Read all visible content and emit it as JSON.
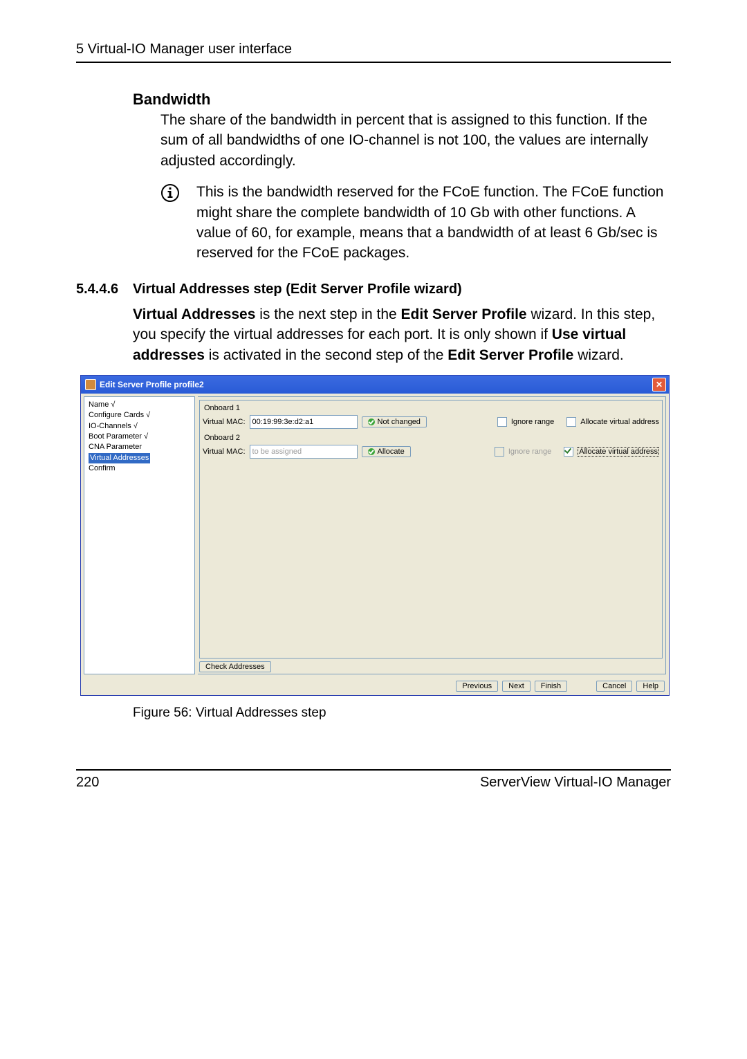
{
  "header": {
    "chapter": "5 Virtual-IO Manager user interface"
  },
  "bandwidth": {
    "title": "Bandwidth",
    "body": "The share of the bandwidth in percent that is assigned to this function. If the sum of all bandwidths of one IO-channel is not 100, the values are internally adjusted accordingly.",
    "note": "This is the bandwidth reserved for the FCoE function. The FCoE function might share the complete bandwidth of 10 Gb with other functions. A value of 60, for example, means that a bandwidth of at least 6 Gb/sec is reserved for the FCoE packages."
  },
  "subheading": {
    "num": "5.4.4.6",
    "text": "Virtual Addresses step (Edit Server Profile wizard)"
  },
  "para_parts": {
    "p1a": "Virtual Addresses",
    "p1b": " is the next step in the ",
    "p1c": "Edit Server Profile",
    "p1d": " wizard. In this step, you specify the virtual addresses for each port. It is only shown if ",
    "p1e": "Use virtual addresses",
    "p1f": " is activated in the second step of the ",
    "p1g": "Edit Server Profile",
    "p1h": " wizard."
  },
  "dialog": {
    "title": "Edit Server Profile profile2",
    "tree": {
      "items": [
        {
          "label": "Name",
          "checked": true,
          "selected": false
        },
        {
          "label": "Configure Cards",
          "checked": true,
          "selected": false
        },
        {
          "label": "IO-Channels",
          "checked": true,
          "selected": false
        },
        {
          "label": "Boot Parameter",
          "checked": true,
          "selected": false
        },
        {
          "label": "CNA Parameter",
          "checked": false,
          "selected": false
        },
        {
          "label": "Virtual Addresses",
          "checked": false,
          "selected": true
        },
        {
          "label": "Confirm",
          "checked": false,
          "selected": false
        }
      ]
    },
    "onboard1": {
      "group": "Onboard 1",
      "mac_label": "Virtual MAC:",
      "mac_value": "00:19:99:3e:d2:a1",
      "action_label": "Not changed",
      "ignore_label": "Ignore range",
      "ignore_checked": false,
      "allocate_label": "Allocate virtual address",
      "allocate_checked": false
    },
    "onboard2": {
      "group": "Onboard 2",
      "mac_label": "Virtual MAC:",
      "mac_placeholder": "to be assigned",
      "action_label": "Allocate",
      "ignore_label": "Ignore range",
      "ignore_checked": false,
      "ignore_disabled": true,
      "allocate_label": "Allocate virtual address",
      "allocate_checked": true,
      "allocate_focused": true
    },
    "check_addresses": "Check Addresses",
    "buttons": {
      "previous": "Previous",
      "next": "Next",
      "finish": "Finish",
      "cancel": "Cancel",
      "help": "Help"
    }
  },
  "figure": {
    "caption": "Figure 56: Virtual Addresses step"
  },
  "footer": {
    "page": "220",
    "product": "ServerView Virtual-IO Manager"
  }
}
